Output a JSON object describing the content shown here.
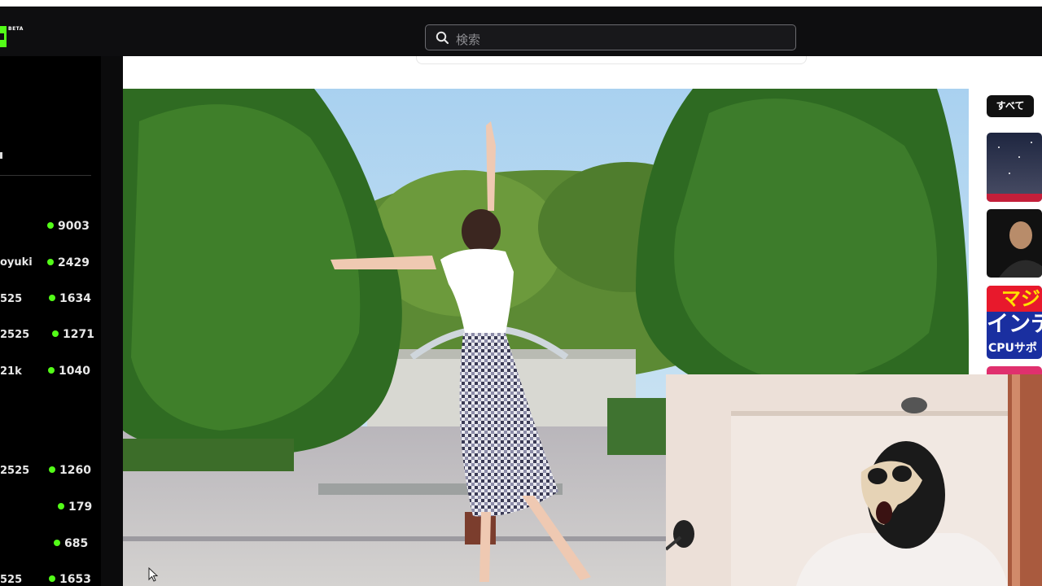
{
  "header": {
    "logo_badge": "BETA",
    "search_placeholder": "検索"
  },
  "sidebar": {
    "channels": [
      {
        "name": "",
        "viewers": "9003"
      },
      {
        "name": "oyuki",
        "viewers": "2429"
      },
      {
        "name": "525",
        "viewers": "1634"
      },
      {
        "name": "2525",
        "viewers": "1271"
      },
      {
        "name": "21k",
        "viewers": "1040"
      },
      {
        "name": "2525",
        "viewers": "1260"
      },
      {
        "name": "",
        "viewers": "179"
      },
      {
        "name": "",
        "viewers": "685"
      },
      {
        "name": "525",
        "viewers": "1653"
      }
    ]
  },
  "right_panel": {
    "filter_all": "すべて",
    "thumbnails": [
      {
        "alt": "night-sky-thumbnail"
      },
      {
        "alt": "person-portrait-thumbnail"
      },
      {
        "line1": "マジ",
        "line2": "インテ",
        "line3": "CPUサポ"
      }
    ]
  },
  "colors": {
    "live_dot": "#53fc18",
    "topbar": "#0e0e10",
    "search_bg": "#18181b"
  }
}
